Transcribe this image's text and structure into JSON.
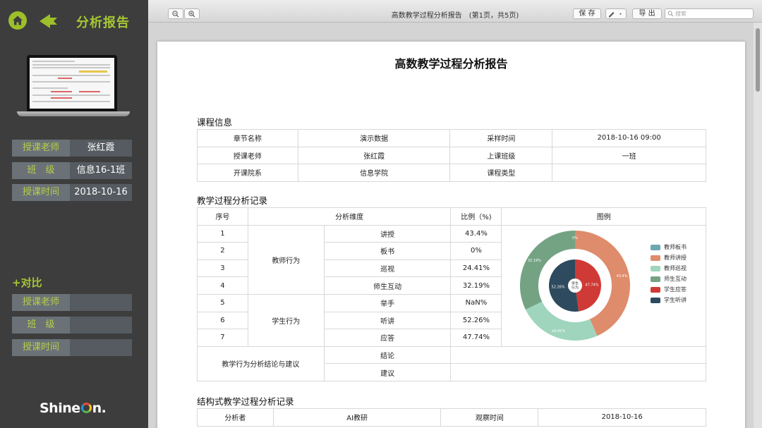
{
  "sidebar": {
    "title": "分析报告",
    "info": [
      {
        "label": "授课老师",
        "value": "张红霞"
      },
      {
        "label": "班　级",
        "value": "信息16-1班"
      },
      {
        "label": "授课时间",
        "value": "2018-10-16"
      }
    ],
    "compare_title": "+对比",
    "compare": [
      {
        "label": "授课老师",
        "value": ""
      },
      {
        "label": "班　级",
        "value": ""
      },
      {
        "label": "授课时间",
        "value": ""
      }
    ],
    "logo_prefix": "ShineO",
    "logo_suffix": "n.",
    "logo_full": "ShineOn."
  },
  "viewer": {
    "doc_title": "高数教学过程分析报告　(第1页，共5页)",
    "save_label": "保 存",
    "export_label": "导 出",
    "search_placeholder": "搜索"
  },
  "report": {
    "title": "高数教学过程分析报告",
    "course_info_title": "课程信息",
    "course_info": [
      [
        "章节名称",
        "演示数据",
        "采样时间",
        "2018-10-16 09:00"
      ],
      [
        "授课老师",
        "张红霞",
        "上课班级",
        "一班"
      ],
      [
        "开课院系",
        "信息学院",
        "课程类型",
        ""
      ]
    ],
    "process_title": "教学过程分析记录",
    "process_headers": [
      "序号",
      "分析维度",
      "比例（%)",
      "图例"
    ],
    "groups": [
      "教师行为",
      "学生行为"
    ],
    "rows": [
      {
        "no": "1",
        "item": "讲授",
        "ratio": "43.4%"
      },
      {
        "no": "2",
        "item": "板书",
        "ratio": "0%"
      },
      {
        "no": "3",
        "item": "巡视",
        "ratio": "24.41%"
      },
      {
        "no": "4",
        "item": "师生互动",
        "ratio": "32.19%"
      },
      {
        "no": "5",
        "item": "举手",
        "ratio": "NaN%"
      },
      {
        "no": "6",
        "item": "听讲",
        "ratio": "52.26%"
      },
      {
        "no": "7",
        "item": "应答",
        "ratio": "47.74%"
      }
    ],
    "conclusion_label": "教学行为分析结论与建议",
    "conclusion_items": [
      "结论",
      "建议"
    ],
    "structured_title": "结构式教学过程分析记录",
    "structured_row": [
      "分析者",
      "AI教研",
      "观察时间",
      "2018-10-16"
    ]
  },
  "chart_data": {
    "type": "pie",
    "center_label": "学生\n行为",
    "outer": [
      {
        "name": "教师板书",
        "value": 0,
        "label": "0%",
        "color": "#6aa8b4"
      },
      {
        "name": "教师讲授",
        "value": 43.4,
        "label": "43.4%",
        "color": "#df8c6c"
      },
      {
        "name": "教师巡视",
        "value": 24.41,
        "label": "24.41%",
        "color": "#9fd5bd"
      },
      {
        "name": "师生互动",
        "value": 32.19,
        "label": "32.19%",
        "color": "#74a383"
      }
    ],
    "inner": [
      {
        "name": "学生应答",
        "value": 47.74,
        "label": "47.74%",
        "color": "#d03a36"
      },
      {
        "name": "学生听讲",
        "value": 52.26,
        "label": "52.26%",
        "color": "#2e4a5e"
      }
    ],
    "legend": [
      "教师板书",
      "教师讲授",
      "教师巡视",
      "师生互动",
      "学生应答",
      "学生听讲"
    ],
    "legend_placement": "right"
  },
  "colors": {
    "accent": "#a6c634",
    "sidebar_bg": "#3d3d3d",
    "label_bg": "#6a7278"
  }
}
